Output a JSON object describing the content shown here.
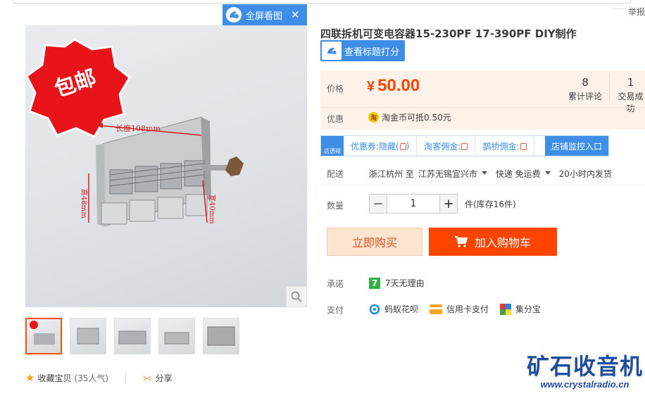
{
  "header": {
    "report_label": "举报"
  },
  "fullscreen": {
    "label": "全屏看图",
    "close": "✕"
  },
  "product": {
    "title": "四联拆机可变电容器15-230PF 17-390PF DIY制作",
    "badge": "包邮",
    "dim_length": "长度108mm",
    "dim_height": "高48mm",
    "dim_width": "宽40mm"
  },
  "rate_button": {
    "label": "查看标题打分"
  },
  "price": {
    "label": "价格",
    "currency": "¥",
    "value": "50.00",
    "reviews_count": "8",
    "reviews_label": "累计评论",
    "sales_count": "1",
    "sales_label": "交易成功",
    "promo_label": "优惠",
    "promo_icon": "淘",
    "promo_text": "淘金币可抵0.50元"
  },
  "coupon_bar": {
    "logo_text": "店透视",
    "items": [
      "优惠券:隐藏(",
      "淘客佣金:",
      "鹊桥佣金:"
    ],
    "monitor_label": "店铺监控入口"
  },
  "shipping": {
    "label": "配送",
    "from": "浙江杭州 至",
    "to": "江苏无锡宜兴市",
    "method": "快递 免运费",
    "dispatch": "20小时内发货"
  },
  "quantity": {
    "label": "数量",
    "minus": "−",
    "value": "1",
    "plus": "+",
    "stock": "件(库存16件)"
  },
  "actions": {
    "buy_now": "立即购买",
    "add_to_cart": "加入购物车"
  },
  "promise": {
    "label": "承诺",
    "icon": "7",
    "text": "7天无理由"
  },
  "payment": {
    "label": "支付",
    "methods": [
      "蚂蚁花呗",
      "信用卡支付",
      "集分宝"
    ]
  },
  "collect": {
    "label": "收藏宝贝",
    "popularity": "(35人气)",
    "share": "分享"
  },
  "watermark": {
    "title": "矿石收音机",
    "url": "www.crystalradio.cn"
  },
  "colors": {
    "accent": "#ff4400",
    "blue": "#3e8ee8",
    "price_bg": "#fff2e8"
  }
}
